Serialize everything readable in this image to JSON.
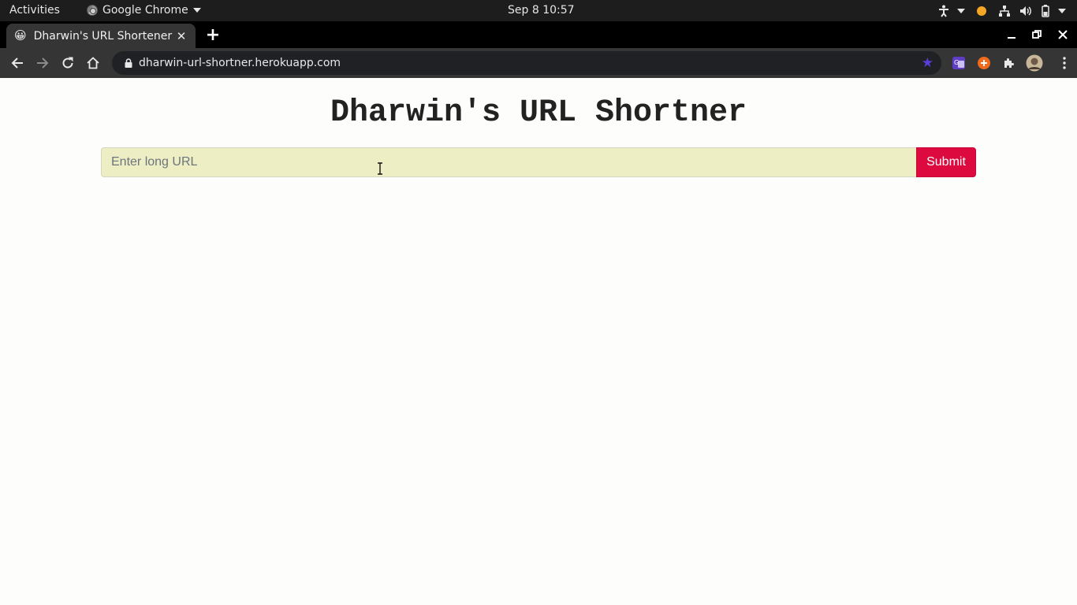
{
  "system_bar": {
    "activities": "Activities",
    "app_name": "Google Chrome",
    "clock": "Sep 8  10:57"
  },
  "browser": {
    "tab_title": "Dharwin's URL Shortener",
    "tab_favicon": "😀",
    "new_tab": "+",
    "url": "dharwin-url-shortner.herokuapp.com"
  },
  "page": {
    "title": "Dharwin's URL Shortner",
    "input_placeholder": "Enter long URL",
    "input_value": "",
    "submit_label": "Submit"
  },
  "colors": {
    "submit_bg": "#dc0a3f",
    "input_bg": "#eeeec4",
    "notification_dot": "#f5a623",
    "bookmark_star": "#5b3ddc"
  }
}
